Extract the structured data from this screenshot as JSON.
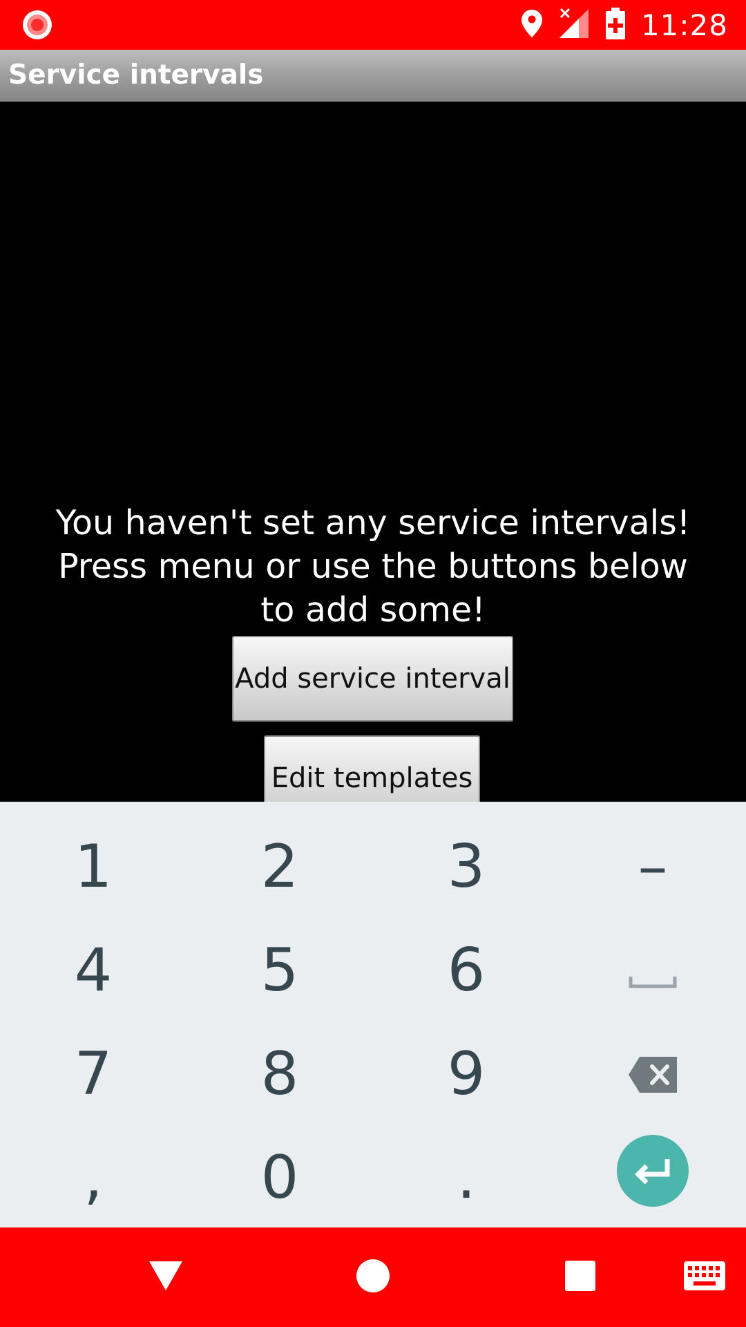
{
  "status_bar": {
    "time": "11:28",
    "icons": [
      "record-icon",
      "location-icon",
      "signal-no-service-icon",
      "battery-charging-icon"
    ]
  },
  "app": {
    "title": "Service intervals"
  },
  "main": {
    "empty_message": "You haven't set any service intervals!\nPress menu or use the buttons below\nto add some!",
    "add_button": "Add service interval",
    "edit_button": "Edit templates"
  },
  "keyboard": {
    "rows": [
      [
        "1",
        "2",
        "3",
        "–"
      ],
      [
        "4",
        "5",
        "6",
        "space-icon"
      ],
      [
        "7",
        "8",
        "9",
        "backspace-icon"
      ],
      [
        ",",
        "0",
        ".",
        "enter-icon"
      ]
    ],
    "accent_color": "#4db6ac"
  },
  "nav_bar": {
    "icons": [
      "back-icon",
      "home-icon",
      "recents-icon",
      "keyboard-icon"
    ],
    "color": "#ff0000"
  }
}
